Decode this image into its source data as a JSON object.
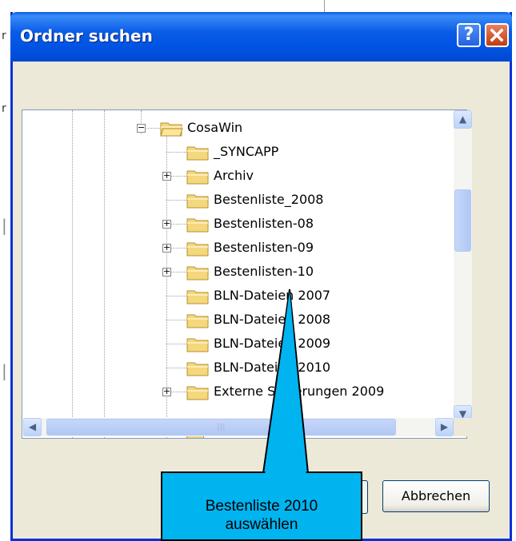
{
  "background": {
    "side_marks": [
      "r",
      "r",
      "r",
      "r"
    ]
  },
  "dialog": {
    "title": "Ordner suchen",
    "help_label": "?",
    "close_label": "✕"
  },
  "tree": {
    "items": [
      {
        "label": "CosaWin",
        "expander": "−",
        "icon": "open-folder-icon"
      },
      {
        "label": "_SYNCAPP",
        "expander": "",
        "icon": "folder-icon"
      },
      {
        "label": "Archiv",
        "expander": "+",
        "icon": "folder-icon"
      },
      {
        "label": "Bestenliste_2008",
        "expander": "",
        "icon": "folder-icon"
      },
      {
        "label": "Bestenlisten-08",
        "expander": "+",
        "icon": "folder-icon"
      },
      {
        "label": "Bestenlisten-09",
        "expander": "+",
        "icon": "folder-icon"
      },
      {
        "label": "Bestenlisten-10",
        "expander": "+",
        "icon": "folder-icon"
      },
      {
        "label": "BLN-Dateien 2007",
        "expander": "",
        "icon": "folder-icon"
      },
      {
        "label": "BLN-Dateien 2008",
        "expander": "",
        "icon": "folder-icon"
      },
      {
        "label": "BLN-Dateien 2009",
        "expander": "",
        "icon": "folder-icon"
      },
      {
        "label": "BLN-Dateien 2010",
        "expander": "",
        "icon": "folder-icon"
      },
      {
        "label": "Externe Sicherungen 2009",
        "expander": "+",
        "icon": "folder-icon"
      }
    ],
    "vertical_scroll_position": 0.33,
    "horizontal_scroll_position": 0.0
  },
  "buttons": {
    "cancel_label": "Abbrechen"
  },
  "callout": {
    "line1": "Bestenliste 2010",
    "line2": "auswählen",
    "fill_color": "#00b4f0"
  },
  "colors": {
    "titlebar": "#0054e3",
    "dialog_face": "#ece9d8",
    "folder": "#f5d77e"
  }
}
